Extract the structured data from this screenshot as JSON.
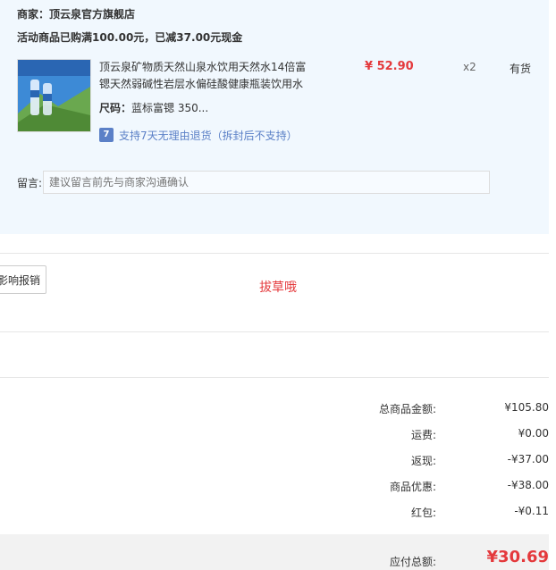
{
  "shop": {
    "title": "商家：顶云泉官方旗舰店",
    "promo": "活动商品已购满100.00元，已减37.00元现金"
  },
  "product": {
    "title": "顶云泉矿物质天然山泉水饮用天然水14倍富锶天然弱碱性岩层水偏硅酸健康瓶装饮用水",
    "price": "¥ 52.90",
    "quantity": "x2",
    "stock": "有货",
    "spec_label": "尺码：",
    "spec_value": "蓝标富锶 350...",
    "return_badge": "7",
    "return_text": "支持7天无理由退货（拆封后不支持）",
    "thumb_icon": "product-image"
  },
  "message": {
    "label": "留言:",
    "placeholder": "建议留言前先与商家沟通确认"
  },
  "report_button": "影响报销",
  "note": "拔草哦",
  "summary": [
    {
      "label": "总商品金额:",
      "value": "¥105.80"
    },
    {
      "label": "运费:",
      "value": "¥0.00"
    },
    {
      "label": "返现:",
      "value": "-¥37.00"
    },
    {
      "label": "商品优惠:",
      "value": "-¥38.00"
    },
    {
      "label": "红包:",
      "value": "-¥0.11"
    }
  ],
  "total": {
    "label": "应付总额:",
    "value": "¥30.69"
  },
  "colors": {
    "accent_red": "#e4393c",
    "panel_bg": "#f1f8fe",
    "link_blue": "#5b80c7"
  }
}
